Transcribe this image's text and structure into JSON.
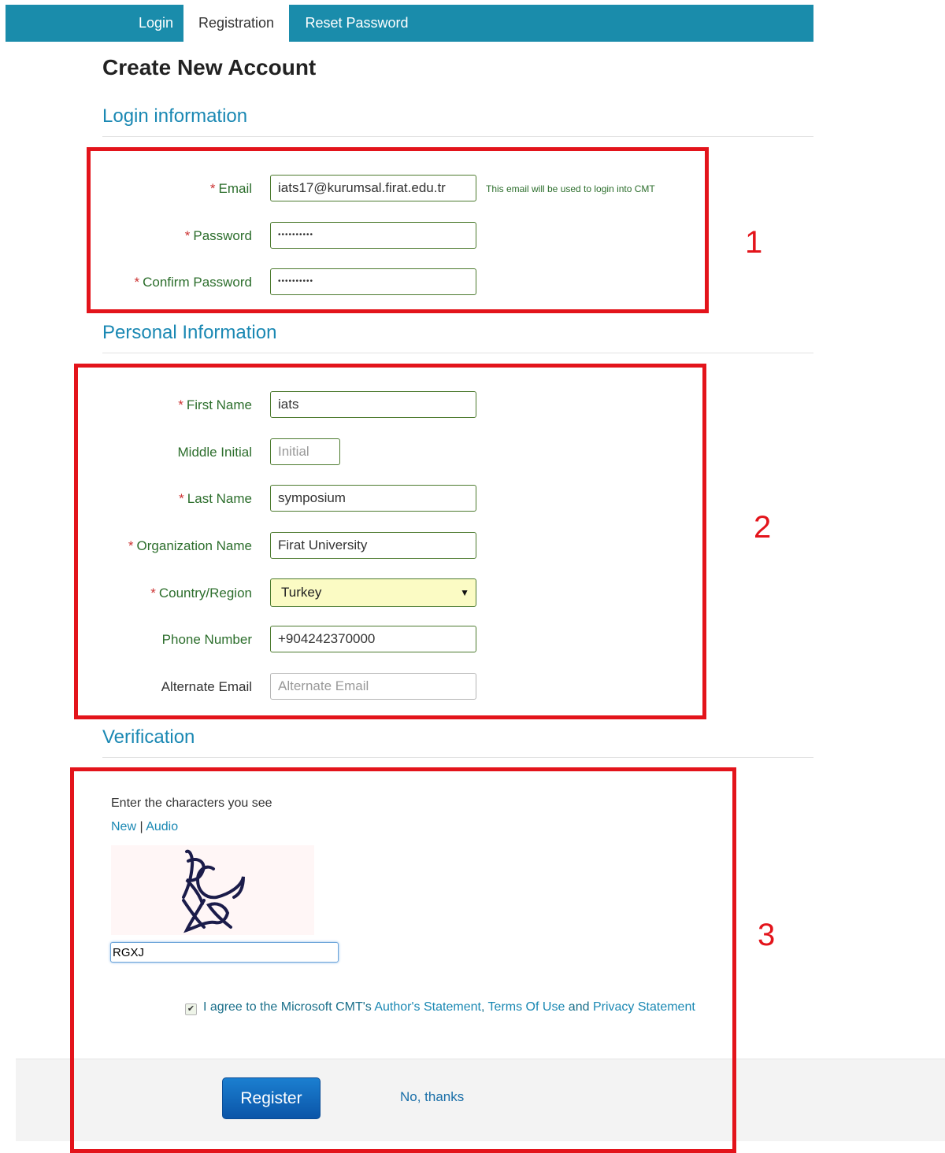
{
  "nav": {
    "tabs": [
      {
        "label": "Login"
      },
      {
        "label": "Registration",
        "active": true
      },
      {
        "label": "Reset Password"
      }
    ]
  },
  "page_title": "Create New Account",
  "required_marker": "*",
  "sections": {
    "login": "Login information",
    "personal": "Personal Information",
    "verification": "Verification"
  },
  "login_info": {
    "email_label": "Email",
    "email_value": "iats17@kurumsal.firat.edu.tr",
    "email_hint": "This email will be used to login into CMT",
    "password_label": "Password",
    "password_value": "••••••••••",
    "confirm_label": "Confirm Password",
    "confirm_value": "••••••••••"
  },
  "personal_info": {
    "first_name_label": "First Name",
    "first_name_value": "iats",
    "middle_initial_label": "Middle Initial",
    "middle_initial_placeholder": "Initial",
    "last_name_label": "Last Name",
    "last_name_value": "symposium",
    "org_label": "Organization Name",
    "org_value": "Firat University",
    "country_label": "Country/Region",
    "country_value": "Turkey",
    "phone_label": "Phone Number",
    "phone_value": "+904242370000",
    "alt_email_label": "Alternate Email",
    "alt_email_placeholder": "Alternate Email"
  },
  "verification": {
    "instruction": "Enter the characters you see",
    "new_link": "New",
    "separator": "|",
    "audio_link": "Audio",
    "captcha_text": "RGXJ",
    "agree_prefix": "I agree to the Microsoft CMT's ",
    "authors_statement": "Author's Statement",
    "comma": ",",
    "terms_of_use": "Terms Of Use",
    "and": "and",
    "privacy_statement": "Privacy Statement",
    "agree_checked": true
  },
  "annotations": {
    "box1": "1",
    "box2": "2",
    "box3": "3",
    "color": "#e3141b"
  },
  "footer": {
    "register": "Register",
    "no_thanks": "No, thanks"
  }
}
